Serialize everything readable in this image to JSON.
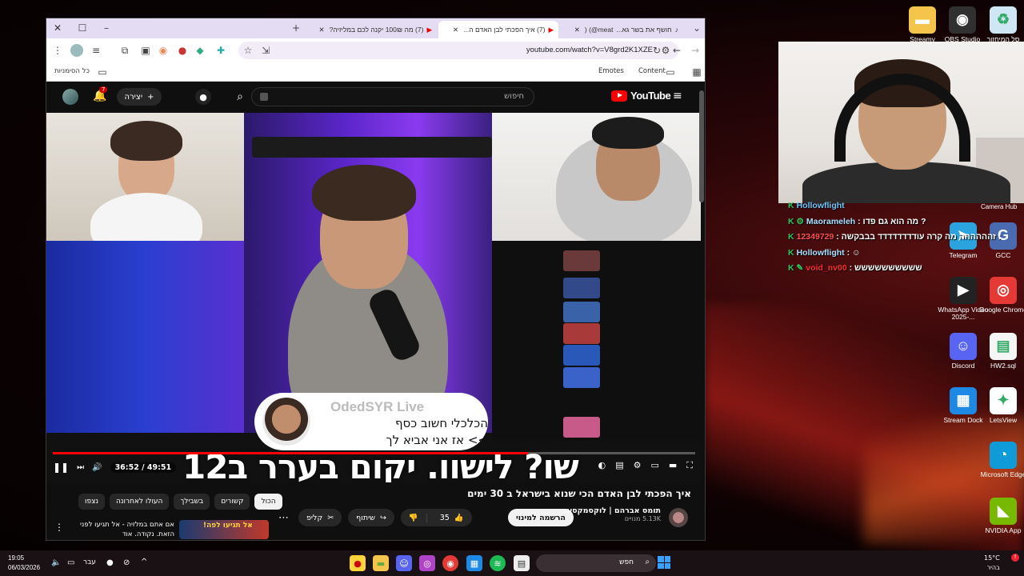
{
  "desktop": {
    "icons": [
      {
        "label": "Streamy",
        "icon": "folder-icon",
        "color": "#f4c54a"
      },
      {
        "label": "OBS Studio",
        "icon": "obs-icon",
        "color": "#303030"
      },
      {
        "label": "סל המיחזור",
        "icon": "recycle-bin-icon",
        "color": "#cfe6f5"
      },
      {
        "label": "Telegram",
        "icon": "telegram-icon",
        "color": "#2aa3df"
      },
      {
        "label": "GCC",
        "icon": "gcc-icon",
        "color": "#4a6bb0"
      },
      {
        "label": "WhatsApp Video 2025-...",
        "icon": "video-file-icon",
        "color": "#222"
      },
      {
        "label": "Google Chrome",
        "icon": "chrome-icon",
        "color": "#e53935"
      },
      {
        "label": "Discord",
        "icon": "discord-icon",
        "color": "#5865f2"
      },
      {
        "label": "HW2.sql",
        "icon": "sql-file-icon",
        "color": "#f5f5f5"
      },
      {
        "label": "Stream Dock",
        "icon": "stream-dock-icon",
        "color": "#1e88e5"
      },
      {
        "label": "LetsView",
        "icon": "letsview-icon",
        "color": "#ffffff"
      },
      {
        "label": "Microsoft Edge",
        "icon": "edge-icon",
        "color": "#0f9bd7"
      },
      {
        "label": "NVIDIA App",
        "icon": "nvidia-icon",
        "color": "#76b900"
      }
    ],
    "camera_label": "Camera Hub"
  },
  "overlay_chat": [
    {
      "user": "Hollowflight",
      "message": ""
    },
    {
      "user": "Maorameleh",
      "message": "מה הוא גם פדו ?"
    },
    {
      "user": "12349729",
      "message": "זהההההה מה קרה עודדדדדדדד בבבקשה :"
    },
    {
      "user": "Hollowflight",
      "message": ""
    },
    {
      "user": "void_nv00",
      "message": "שששששששששש"
    }
  ],
  "browser": {
    "tabs": [
      {
        "title": "חושף את בשר גא...",
        "icon": "tiktok-icon"
      },
      {
        "title": "meat@) (",
        "icon": "tiktok-icon"
      },
      {
        "title": "(7) איך הפכתי לבן האדם ה...",
        "icon": "youtube-icon",
        "active": true
      },
      {
        "title": "(7) מה 100₪ יקנה לכם במליזיה?",
        "icon": "youtube-icon"
      }
    ],
    "url": "youtube.com/watch?v=V8grd2K1XZE",
    "bookmarks_label": "כל הסימניות",
    "bookmark_items": [
      "Content",
      "Emotes"
    ]
  },
  "youtube": {
    "logo_text": "YouTube",
    "search_placeholder": "חיפוש",
    "create_label": "יצירה",
    "notification_count": "7",
    "player": {
      "current_time": "36:52",
      "duration": "49:51",
      "progress": 0.74,
      "subtitle": "שו? לישוו. יקום בערר ב12",
      "popup_channel": "OdedSYR Live",
      "popup_line1": "הכלכלי חשוב כסף",
      "popup_line2": ">> אז אני אביא לך"
    },
    "video_title": "איך הפכתי לבן האדם הכי שנוא בישראל ב 30 ימים",
    "channel_name": "תומס אברהם | לוקסמקסינג",
    "subscribers": "5.13K מנויים",
    "subscribe_label": "הרשמה למינוי",
    "likes": "35",
    "share_label": "שיתוף",
    "clip_label": "קליפ",
    "chips": [
      "הכול",
      "קשורים",
      "בשבילך",
      "העולו לאחרונה",
      "נצפו"
    ],
    "next_video": {
      "title": "אם אתם במלזיה - אל תגיעו לפני",
      "sub": "הזאת. נקודה. אוד",
      "thumb_text": "אל תגיעו לפה!"
    }
  },
  "taskbar": {
    "time": "19:05",
    "date": "06/03/2026",
    "language": "עבר",
    "search_placeholder": "חפש",
    "weather_temp": "15°C",
    "weather_desc": "בהיר"
  }
}
